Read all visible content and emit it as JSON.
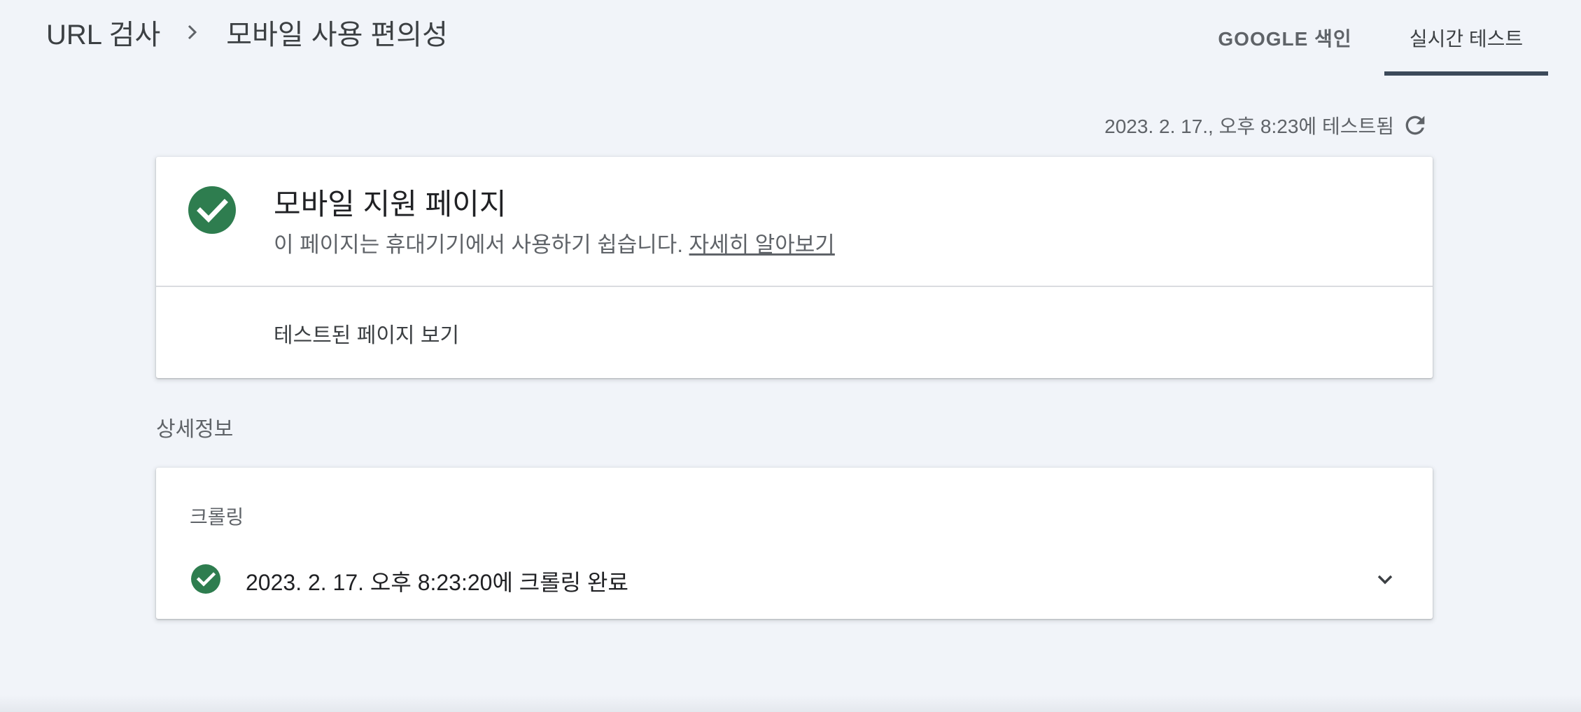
{
  "header": {
    "breadcrumb": {
      "root": "URL 검사",
      "separator_icon": "chevron-right-icon",
      "current": "모바일 사용 편의성"
    },
    "tabs": [
      {
        "label": "GOOGLE 색인",
        "active": false
      },
      {
        "label": "실시간 테스트",
        "active": true
      }
    ]
  },
  "tested": {
    "text": "2023. 2. 17., 오후 8:23에 테스트됨",
    "refresh_icon": "refresh-icon"
  },
  "result": {
    "status_icon": "check-circle-icon",
    "title": "모바일 지원 페이지",
    "description": "이 페이지는 휴대기기에서 사용하기 쉽습니다.",
    "learn_more": "자세히 알아보기",
    "view_tested_page": "테스트된 페이지 보기"
  },
  "details": {
    "heading": "상세정보",
    "crawl": {
      "label": "크롤링",
      "status_icon": "check-circle-icon",
      "text": "2023. 2. 17. 오후 8:23:20에 크롤링 완료",
      "expand_icon": "chevron-down-icon"
    }
  },
  "colors": {
    "background": "#f1f4f9",
    "success_green": "#2e7d4f",
    "active_tab_underline": "#3c4a5a",
    "text_primary": "#202124",
    "text_secondary": "#5f6368"
  }
}
